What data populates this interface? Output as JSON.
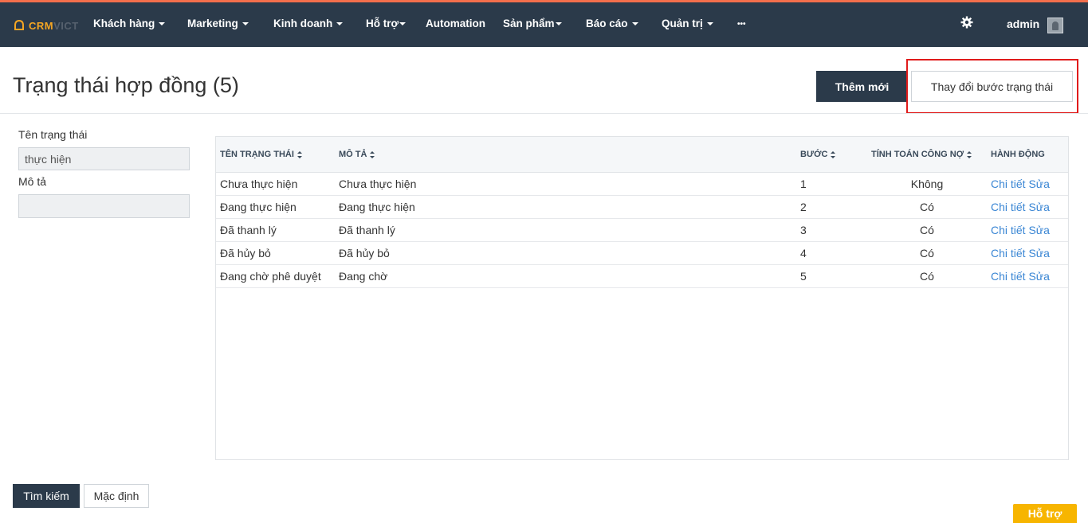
{
  "brand": {
    "part1": "CRM",
    "part2": "VICT"
  },
  "nav": {
    "items": [
      {
        "label": "Khách hàng",
        "caret": true
      },
      {
        "label": "Marketing",
        "caret": true
      },
      {
        "label": "Kinh doanh",
        "caret": true
      },
      {
        "label": "Hỗ trợ",
        "caret": true
      },
      {
        "label": "Automation",
        "caret": false
      },
      {
        "label": "Sản phẩm",
        "caret": true
      },
      {
        "label": "Báo cáo",
        "caret": true
      },
      {
        "label": "Quản trị",
        "caret": true
      },
      {
        "label": "•••",
        "caret": false
      }
    ],
    "settings_icon": "gear-icon",
    "user": "admin"
  },
  "page": {
    "title": "Trạng thái hợp đồng (5)",
    "add_button": "Thêm mới",
    "change_step_button": "Thay đổi bước trạng thái"
  },
  "filters": {
    "name_label": "Tên trạng thái",
    "name_value": "thực hiện",
    "description_label": "Mô tả",
    "description_value": "",
    "search_button": "Tìm kiếm",
    "default_button": "Mặc định"
  },
  "table": {
    "headers": [
      "TÊN TRẠNG THÁI",
      "MÔ TẢ",
      "BƯỚC",
      "TÍNH TOÁN CÔNG NỢ",
      "HÀNH ĐỘNG"
    ],
    "action_detail": "Chi tiết",
    "action_edit": "Sửa",
    "rows": [
      {
        "name": "Chưa thực hiện",
        "description": "Chưa thực hiện",
        "step": "1",
        "debt": "Không"
      },
      {
        "name": "Đang thực hiện",
        "description": "Đang thực hiện",
        "step": "2",
        "debt": "Có"
      },
      {
        "name": "Đã thanh lý",
        "description": "Đã thanh lý",
        "step": "3",
        "debt": "Có"
      },
      {
        "name": "Đã hủy bỏ",
        "description": "Đã hủy bỏ",
        "step": "4",
        "debt": "Có"
      },
      {
        "name": "Đang chờ phê duyệt",
        "description": "Đang chờ",
        "step": "5",
        "debt": "Có"
      }
    ]
  },
  "help_button": "Hỗ trợ",
  "colors": {
    "navbar": "#2b3a4a",
    "accent_top": "#f36f4c",
    "link": "#3a86d4",
    "highlight": "#e01b1b",
    "help": "#f7b500"
  }
}
